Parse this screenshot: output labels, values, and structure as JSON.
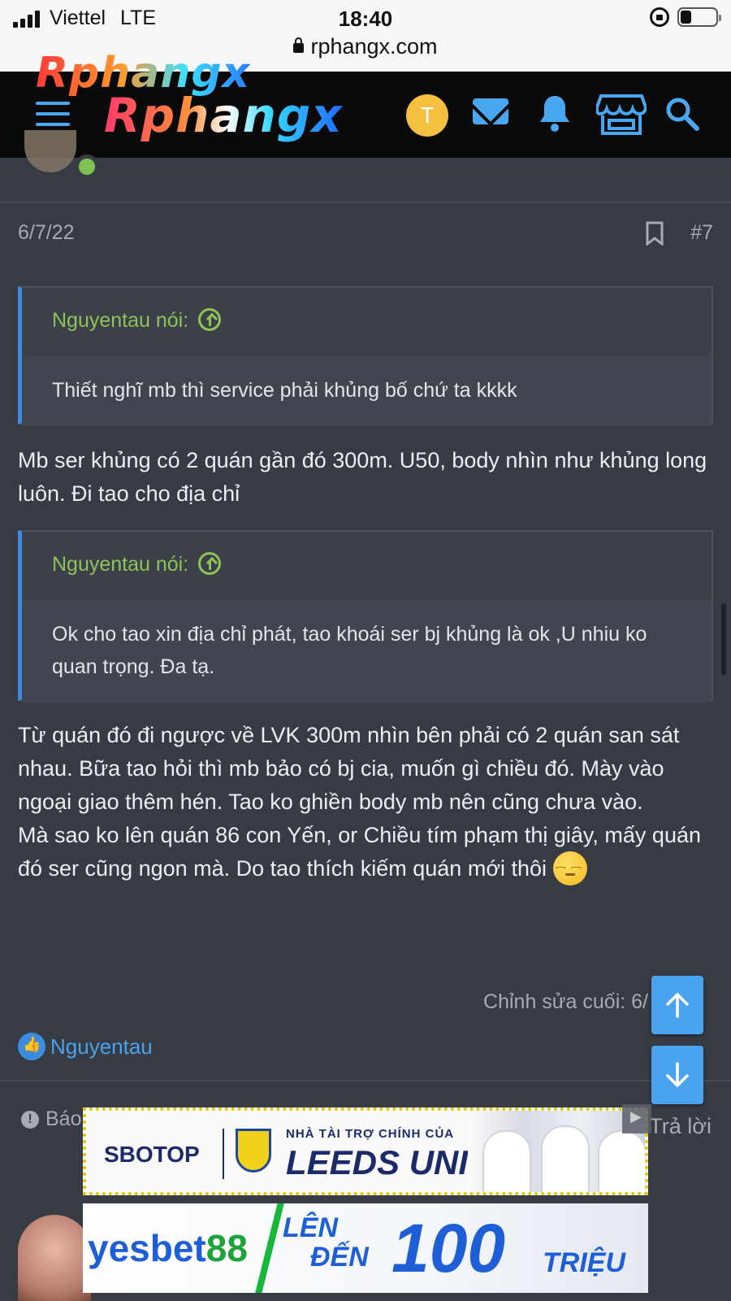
{
  "status_bar": {
    "carrier": "Viettel",
    "network": "LTE",
    "time": "18:40",
    "url": "rphangx.com"
  },
  "header": {
    "logo_top": "Rphangx",
    "logo_main": "Rphangx",
    "user_initial": "T",
    "icons": [
      "menu-icon",
      "mail-icon",
      "bell-icon",
      "shop-icon",
      "search-icon"
    ],
    "accent_color": "#48a7ee"
  },
  "post": {
    "date": "6/7/22",
    "number": "#7",
    "quotes": [
      {
        "author_label": "Nguyentau nói:",
        "text": "Thiết nghĩ mb thì service phải khủng bố chứ ta kkkk"
      },
      {
        "author_label": "Nguyentau nói:",
        "text": "Ok cho tao xin địa chỉ phát, tao khoái ser bj khủng là ok ,U nhiu ko quan trọng. Đa tạ."
      }
    ],
    "reply_1": "Mb ser khủng có 2 quán gần đó 300m. U50, body nhìn như khủng long luôn. Đi tao cho địa chỉ",
    "reply_2_lines": [
      "Từ quán đó đi ngược về LVK 300m nhìn bên phải có 2 quán san sát nhau. Bữa tao hỏi thì mb bảo có bj cia, muốn gì chiều đó. Mày vào ngoại giao thêm hén. Tao ko ghiền body mb nên cũng chưa vào.",
      "Mà sao ko lên quán 86 con Yến, or Chiều tím phạm thị giây, mấy quán đó ser cũng ngon mà. Do tao thích kiếm quán mới thôi"
    ],
    "edited": "Chỉnh sửa cuối: 6/",
    "liked_by": "Nguyentau",
    "report_label": "Báo",
    "reply_label": "Trả lời"
  },
  "ads": {
    "sbotop": {
      "brand": "SBOTOP",
      "sponsor_line": "NHÀ TÀI TRỢ CHÍNH CỦA",
      "club": "LEEDS UNITED"
    },
    "yesbet": {
      "brand_a": "yesbet",
      "brand_b": "88",
      "line1": "LÊN",
      "line2": "ĐẾN",
      "amount": "100",
      "unit": "TRIỆU"
    }
  },
  "colors": {
    "background": "#363b44",
    "quote_author": "#8fc357",
    "link": "#4aa3ee"
  }
}
